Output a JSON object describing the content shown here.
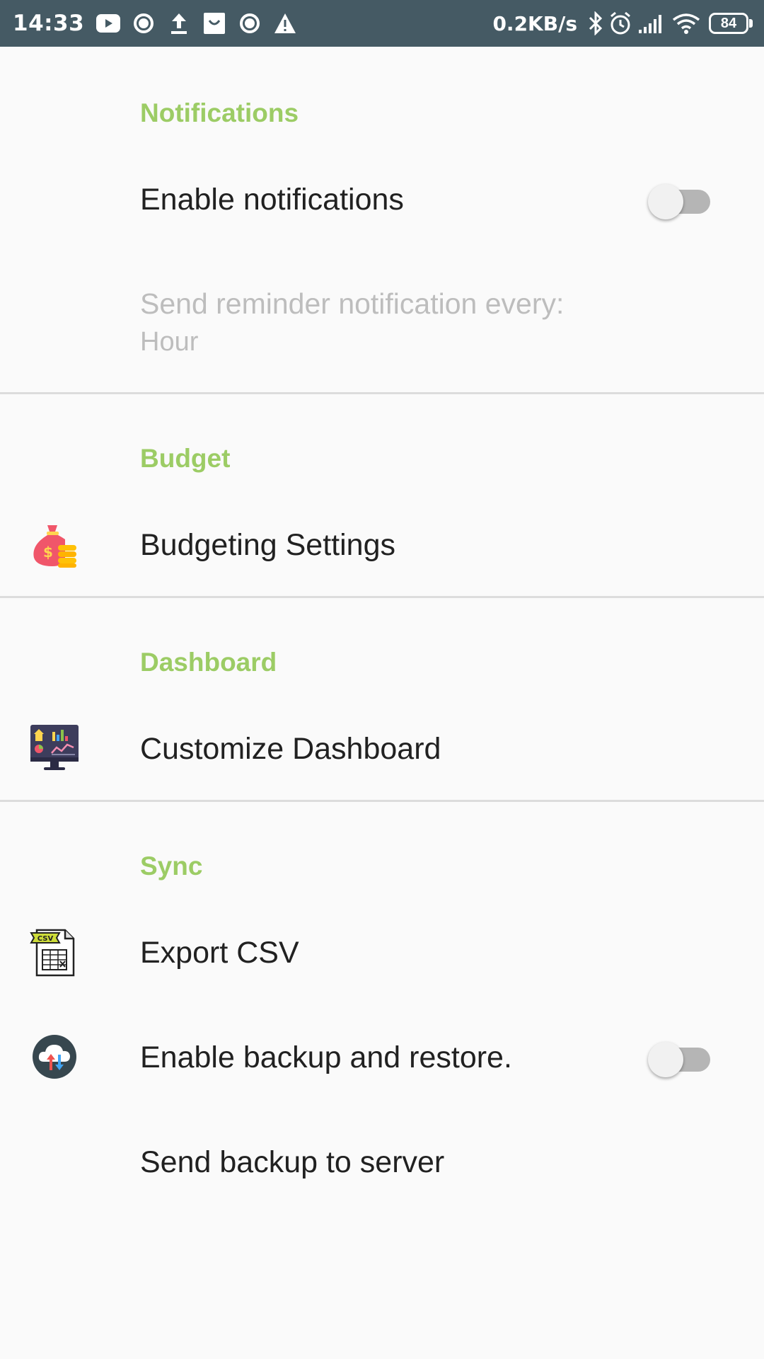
{
  "status_bar": {
    "time": "14:33",
    "net_speed": "0.2KB/s",
    "battery": "84",
    "battery_level": 0.84,
    "left_icons": [
      "youtube-icon",
      "circle-record-icon",
      "upload-icon",
      "shopping-bag-icon",
      "circle-record-icon",
      "warning-icon"
    ],
    "right_icons": [
      "bluetooth-icon",
      "alarm-icon",
      "signal-icon",
      "wifi-icon",
      "battery-icon"
    ]
  },
  "sections": {
    "notifications": {
      "title": "Notifications",
      "enable_label": "Enable notifications",
      "enable_state": false,
      "reminder_label": "Send reminder notification every:",
      "reminder_value": "Hour"
    },
    "budget": {
      "title": "Budget",
      "settings_label": "Budgeting Settings",
      "icon": "money-bag-icon"
    },
    "dashboard": {
      "title": "Dashboard",
      "customize_label": "Customize Dashboard",
      "icon": "dashboard-monitor-icon"
    },
    "sync": {
      "title": "Sync",
      "export_label": "Export CSV",
      "export_icon": "csv-file-icon",
      "backup_label": "Enable backup and restore.",
      "backup_icon": "cloud-sync-icon",
      "backup_state": false,
      "send_label": "Send backup to server"
    }
  },
  "colors": {
    "status_bar": "#455a64",
    "accent": "#9ccc65",
    "background": "#fafafa",
    "text": "#212121",
    "disabled_text": "#bdbdbd"
  }
}
